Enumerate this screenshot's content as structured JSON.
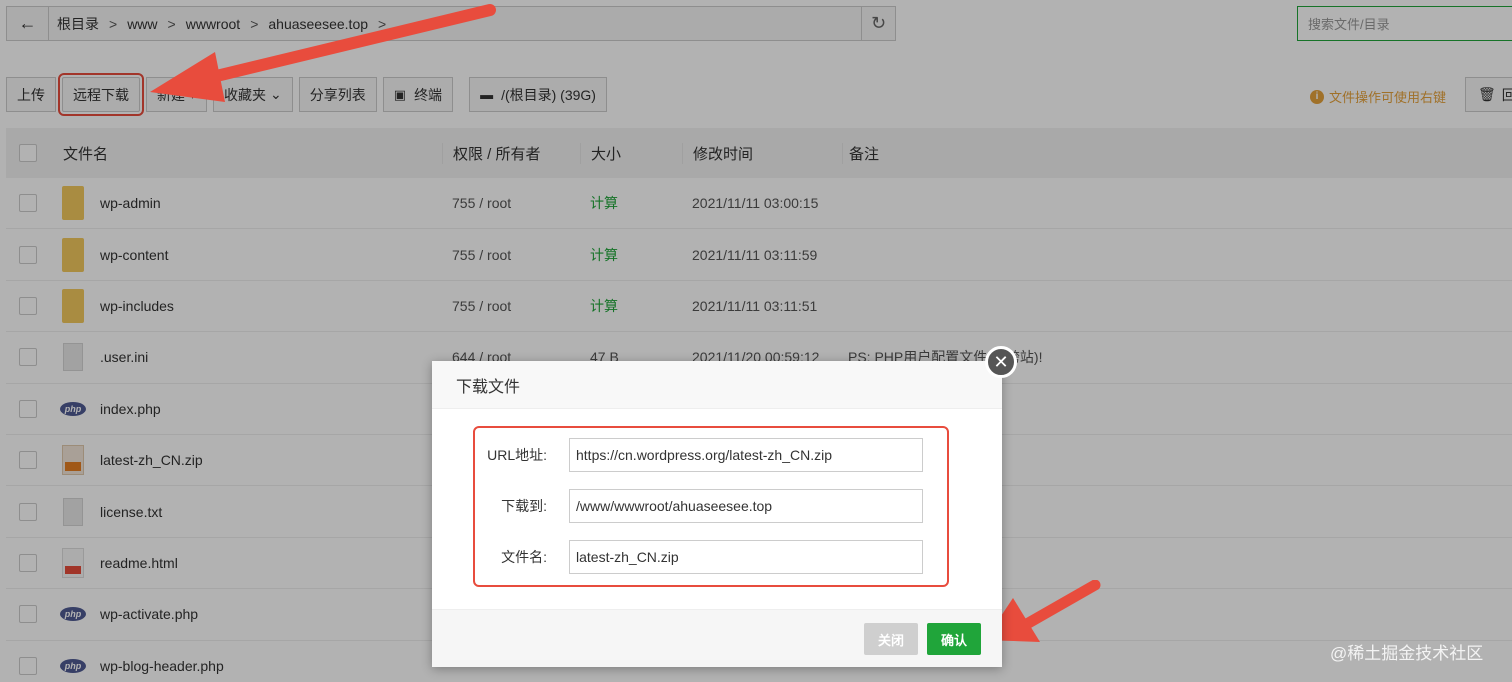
{
  "pathbar": {
    "back_icon": "arrow-left-icon",
    "crumbs": [
      "根目录",
      "www",
      "wwwroot",
      "ahuaseesee.top"
    ],
    "separator": ">",
    "refresh_icon": "refresh-icon"
  },
  "search": {
    "placeholder": "搜索文件/目录"
  },
  "toolbar": {
    "upload": "上传",
    "remote_download": "远程下载",
    "new": "新建",
    "new_caret": "▾",
    "favorites": "收藏夹",
    "favorites_caret": "⌄",
    "share_list": "分享列表",
    "terminal": "终端",
    "disk": "/(根目录) (39G)",
    "hint": "文件操作可使用右键",
    "recycle": "回"
  },
  "table": {
    "headers": {
      "name": "文件名",
      "perm": "权限 / 所有者",
      "size": "大小",
      "time": "修改时间",
      "note": "备注"
    },
    "rows": [
      {
        "icon": "folder",
        "name": "wp-admin",
        "perm": "755 / root",
        "size": "计算",
        "time": "2021/11/11 03:00:15",
        "note": ""
      },
      {
        "icon": "folder",
        "name": "wp-content",
        "perm": "755 / root",
        "size": "计算",
        "time": "2021/11/11 03:11:59",
        "note": ""
      },
      {
        "icon": "folder",
        "name": "wp-includes",
        "perm": "755 / root",
        "size": "计算",
        "time": "2021/11/11 03:11:51",
        "note": ""
      },
      {
        "icon": "file",
        "name": ".user.ini",
        "perm": "644 / root",
        "size": "47 B",
        "time": "2021/11/20 00:59:12",
        "note": "PS: PHP用户配置文件(防跨站)!"
      },
      {
        "icon": "php",
        "name": "index.php",
        "perm": "",
        "size": "",
        "time": "",
        "note": ""
      },
      {
        "icon": "zip",
        "name": "latest-zh_CN.zip",
        "perm": "",
        "size": "",
        "time": "",
        "note": ""
      },
      {
        "icon": "file",
        "name": "license.txt",
        "perm": "",
        "size": "",
        "time": "",
        "note": ""
      },
      {
        "icon": "html",
        "name": "readme.html",
        "perm": "",
        "size": "",
        "time": "",
        "note": ""
      },
      {
        "icon": "php",
        "name": "wp-activate.php",
        "perm": "",
        "size": "",
        "time": "",
        "note": ""
      },
      {
        "icon": "php",
        "name": "wp-blog-header.php",
        "perm": "",
        "size": "",
        "time": "",
        "note": ""
      }
    ]
  },
  "dialog": {
    "title": "下载文件",
    "close_icon": "close-icon",
    "url_label": "URL地址:",
    "url_value": "https://cn.wordpress.org/latest-zh_CN.zip",
    "dest_label": "下载到:",
    "dest_value": "/www/wwwroot/ahuaseesee.top",
    "filename_label": "文件名:",
    "filename_value": "latest-zh_CN.zip",
    "btn_close": "关闭",
    "btn_confirm": "确认"
  },
  "php_badge": "php",
  "watermark": "@稀土掘金技术社区",
  "colors": {
    "accent_green": "#20a53a",
    "annotation_red": "#e84c3d",
    "hint_orange": "#e6a23c"
  }
}
